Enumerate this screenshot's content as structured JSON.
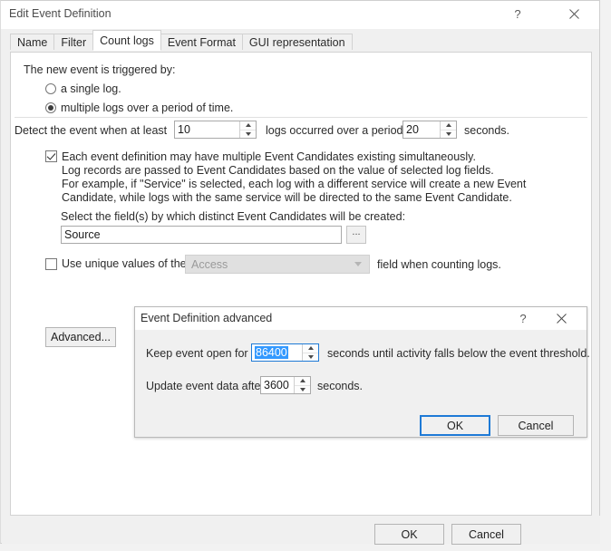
{
  "window": {
    "title": "Edit Event Definition",
    "help_icon": "question-mark-icon",
    "close_icon": "close-icon"
  },
  "tabs": [
    {
      "label": "Name",
      "active": false
    },
    {
      "label": "Filter",
      "active": false
    },
    {
      "label": "Count logs",
      "active": true
    },
    {
      "label": "Event Format",
      "active": false
    },
    {
      "label": "GUI representation",
      "active": false
    }
  ],
  "count_logs": {
    "trigger_heading": "The new event is triggered by:",
    "radio_single": "a single log.",
    "radio_multiple": "multiple logs over a period of time.",
    "selected_radio": "multiple",
    "detect_prefix": "Detect the event when at least",
    "detect_count": "10",
    "detect_middle": "logs occurred over a period of",
    "detect_period": "20",
    "detect_suffix": "seconds.",
    "candidates_checked": true,
    "candidates_lines": [
      "Each event definition may have multiple Event Candidates existing simultaneously.",
      "Log records are passed to Event Candidates based on the value of selected log fields.",
      "For example, if \"Service\" is selected, each log with a different service will create a new Event",
      "Candidate, while logs with the same service will be directed to the same Event Candidate."
    ],
    "field_select_label": "Select the field(s) by which distinct Event Candidates will be created:",
    "field_value": "Source",
    "browse_button": "...",
    "unique_checked": false,
    "unique_prefix": "Use unique values of the",
    "unique_combo_value": "Access",
    "unique_suffix": "field when counting logs.",
    "advanced_button": "Advanced..."
  },
  "footer": {
    "ok": "OK",
    "cancel": "Cancel"
  },
  "modal": {
    "title": "Event Definition advanced",
    "help_icon": "question-mark-icon",
    "close_icon": "close-icon",
    "keep_open_prefix": "Keep event open for",
    "keep_open_value": "86400",
    "keep_open_suffix": "seconds until activity falls below the event threshold.",
    "update_prefix": "Update event data after",
    "update_value": "3600",
    "update_suffix": "seconds.",
    "ok": "OK",
    "cancel": "Cancel"
  },
  "colors": {
    "selection_blue": "#3399ff",
    "focus_blue": "#1e7ad6",
    "panel_bg": "#f0f0f0",
    "content_bg": "#ffffff",
    "text": "#2b2b2b"
  }
}
